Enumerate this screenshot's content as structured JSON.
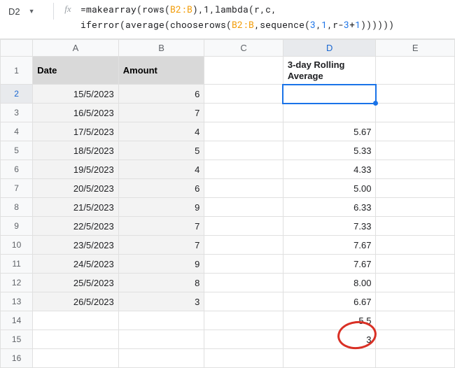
{
  "nameBox": {
    "cell": "D2"
  },
  "formula": {
    "line1_pre": "=makearray(rows(",
    "line1_rng": "B2:B",
    "line1_post": "),1,lambda(r,c,",
    "line2_pre": "iferror(average(chooserows(",
    "line2_rng": "B2:B",
    "line2_mid": ",sequence(",
    "line2_n1": "3",
    "line2_c1": ",",
    "line2_n2": "1",
    "line2_c2": ",r-",
    "line2_n3": "3",
    "line2_c3": "+",
    "line2_n4": "1",
    "line2_post": "))))))"
  },
  "cols": {
    "A": "A",
    "B": "B",
    "C": "C",
    "D": "D",
    "E": "E"
  },
  "headers": {
    "date": "Date",
    "amount": "Amount",
    "d": "3-day Rolling Average"
  },
  "rows": [
    {
      "n": "1"
    },
    {
      "n": "2",
      "a": "15/5/2023",
      "b": "6",
      "d": ""
    },
    {
      "n": "3",
      "a": "16/5/2023",
      "b": "7",
      "d": ""
    },
    {
      "n": "4",
      "a": "17/5/2023",
      "b": "4",
      "d": "5.67"
    },
    {
      "n": "5",
      "a": "18/5/2023",
      "b": "5",
      "d": "5.33"
    },
    {
      "n": "6",
      "a": "19/5/2023",
      "b": "4",
      "d": "4.33"
    },
    {
      "n": "7",
      "a": "20/5/2023",
      "b": "6",
      "d": "5.00"
    },
    {
      "n": "8",
      "a": "21/5/2023",
      "b": "9",
      "d": "6.33"
    },
    {
      "n": "9",
      "a": "22/5/2023",
      "b": "7",
      "d": "7.33"
    },
    {
      "n": "10",
      "a": "23/5/2023",
      "b": "7",
      "d": "7.67"
    },
    {
      "n": "11",
      "a": "24/5/2023",
      "b": "9",
      "d": "7.67"
    },
    {
      "n": "12",
      "a": "25/5/2023",
      "b": "8",
      "d": "8.00"
    },
    {
      "n": "13",
      "a": "26/5/2023",
      "b": "3",
      "d": "6.67"
    },
    {
      "n": "14",
      "a": "",
      "b": "",
      "d": "5.5"
    },
    {
      "n": "15",
      "a": "",
      "b": "",
      "d": "3"
    },
    {
      "n": "16",
      "a": "",
      "b": "",
      "d": ""
    }
  ],
  "chart_data": {
    "type": "table",
    "title": "3-day Rolling Average",
    "columns": [
      "Date",
      "Amount",
      "3-day Rolling Average"
    ],
    "data": [
      [
        "15/5/2023",
        6,
        null
      ],
      [
        "16/5/2023",
        7,
        null
      ],
      [
        "17/5/2023",
        4,
        5.67
      ],
      [
        "18/5/2023",
        5,
        5.33
      ],
      [
        "19/5/2023",
        4,
        4.33
      ],
      [
        "20/5/2023",
        6,
        5.0
      ],
      [
        "21/5/2023",
        9,
        6.33
      ],
      [
        "22/5/2023",
        7,
        7.33
      ],
      [
        "23/5/2023",
        7,
        7.67
      ],
      [
        "24/5/2023",
        9,
        7.67
      ],
      [
        "25/5/2023",
        8,
        8.0
      ],
      [
        "26/5/2023",
        3,
        6.67
      ],
      [
        null,
        null,
        5.5
      ],
      [
        null,
        null,
        3
      ]
    ]
  }
}
